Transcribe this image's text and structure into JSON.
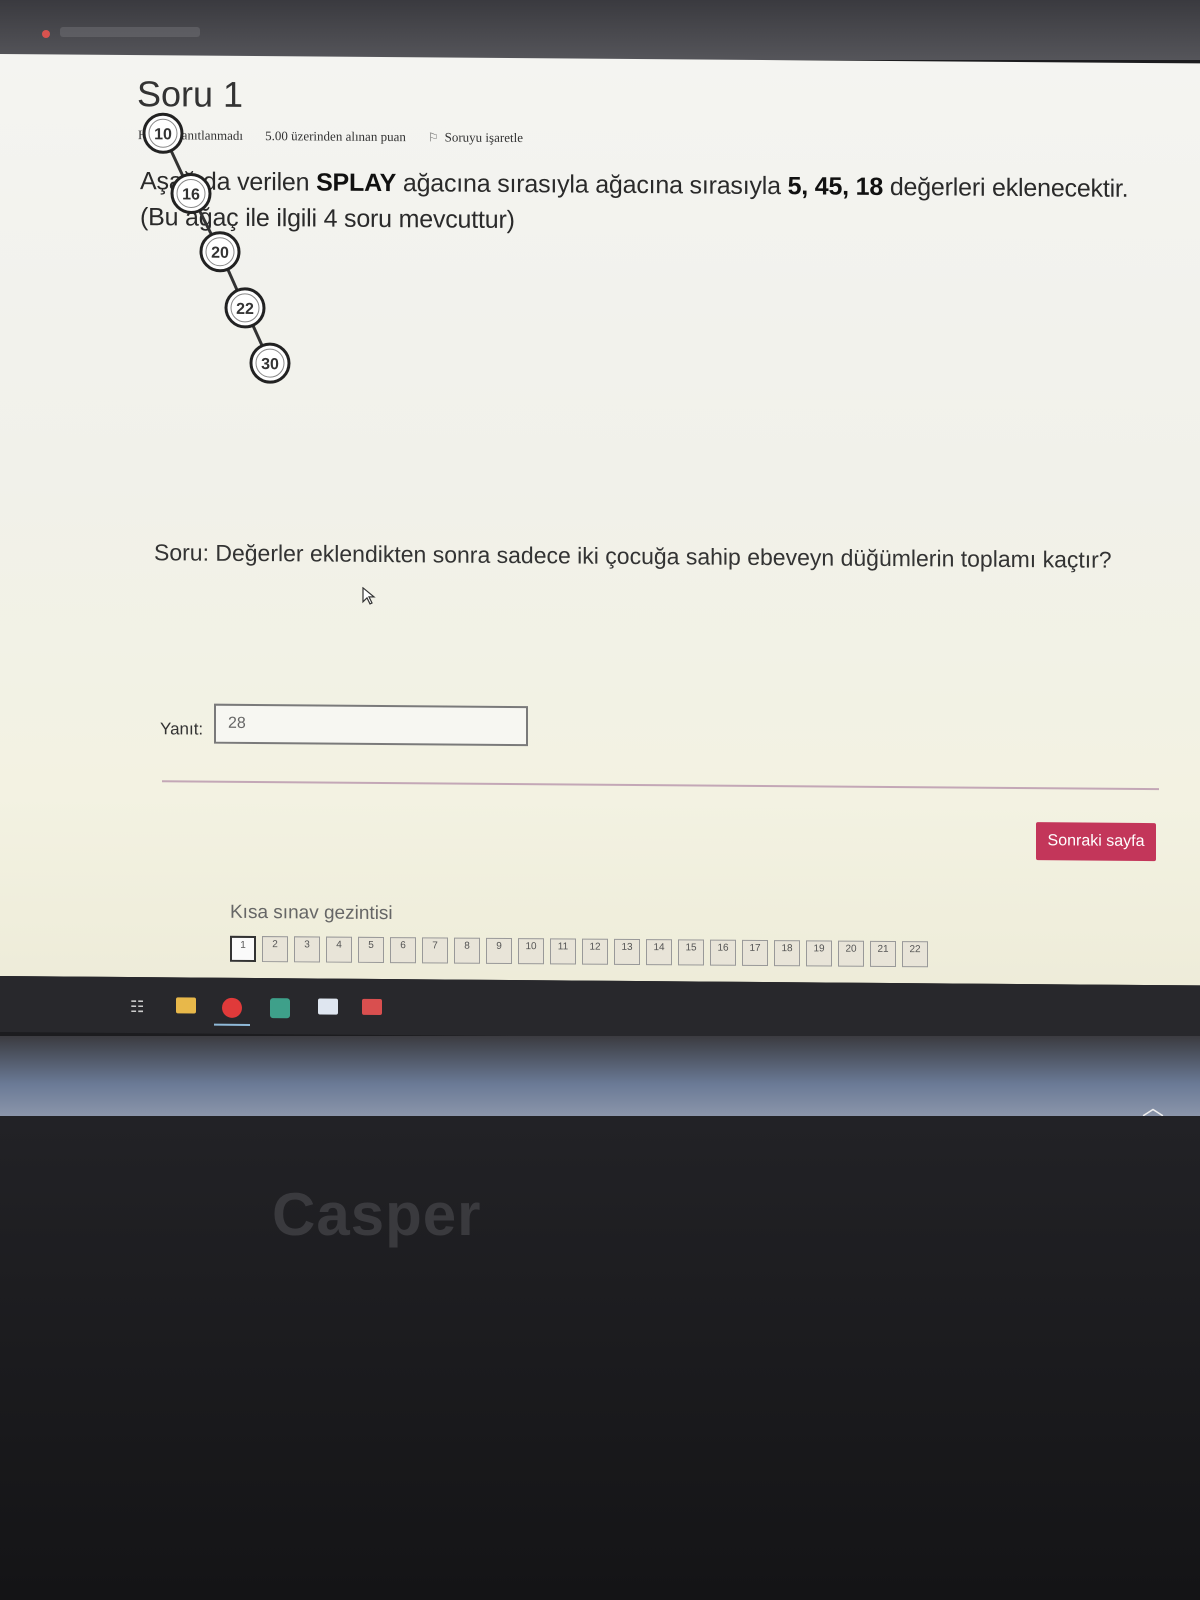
{
  "question": {
    "title": "Soru 1",
    "status": "Henüz yanıtlanmadı",
    "points": "5.00 üzerinden alınan puan",
    "flag_label": "Soruyu işaretle"
  },
  "prompt": {
    "part1": "Aşağıda verilen ",
    "bold1": "SPLAY",
    "part2": " ağacına sırasıyla ağacına sırasıyla ",
    "bold2": "5, 45, 18",
    "part3": " değerleri eklenecektir.",
    "line2": "(Bu ağaç ile ilgili 4 soru mevcuttur)"
  },
  "tree": {
    "nodes": [
      "10",
      "16",
      "20",
      "22",
      "30"
    ]
  },
  "sub_question": "Soru: Değerler eklendikten sonra sadece iki çocuğa sahip ebeveyn düğümlerin toplamı kaçtır?",
  "answer": {
    "label": "Yanıt:",
    "value": "28"
  },
  "next_button": "Sonraki sayfa",
  "navigation": {
    "title": "Kısa sınav gezintisi",
    "items": [
      "1",
      "2",
      "3",
      "4",
      "5",
      "6",
      "7",
      "8",
      "9",
      "10",
      "11",
      "12",
      "13",
      "14",
      "15",
      "16",
      "17",
      "18",
      "19",
      "20",
      "21",
      "22"
    ]
  },
  "brand": "Casper",
  "icons": {
    "cursor": "cursor-icon",
    "flag": "flag-icon",
    "chevron": "chevron-up-icon"
  }
}
